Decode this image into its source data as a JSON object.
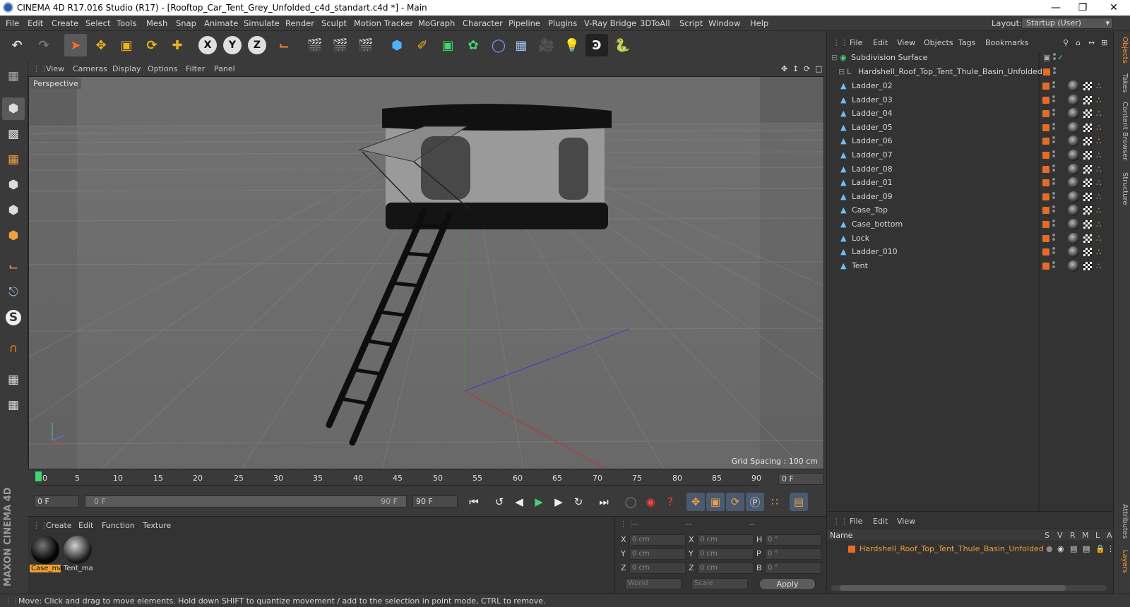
{
  "window": {
    "title": "CINEMA 4D R17.016 Studio (R17) - [Rooftop_Car_Tent_Grey_Unfolded_c4d_standart.c4d *] - Main",
    "minimize": "—",
    "maximize": "❐",
    "close": "✕"
  },
  "menu": [
    "File",
    "Edit",
    "Create",
    "Select",
    "Tools",
    "Mesh",
    "Snap",
    "Animate",
    "Simulate",
    "Render",
    "Sculpt",
    "Motion Tracker",
    "MoGraph",
    "Character",
    "Pipeline",
    "Plugins",
    "V-Ray Bridge",
    "3DToAll",
    "Script",
    "Window",
    "Help"
  ],
  "layout": {
    "label": "Layout:",
    "value": "Startup (User)"
  },
  "toolbar": {
    "x": "X",
    "y": "Y",
    "z": "Z"
  },
  "viewport": {
    "menu": [
      "View",
      "Cameras",
      "Display",
      "Options",
      "Filter",
      "Panel"
    ],
    "label": "Perspective",
    "grid_spacing": "Grid Spacing : 100 cm"
  },
  "timeline": {
    "ticks": [
      "0",
      "5",
      "10",
      "15",
      "20",
      "25",
      "30",
      "35",
      "40",
      "45",
      "50",
      "55",
      "60",
      "65",
      "70",
      "75",
      "80",
      "85",
      "90"
    ],
    "current_frame": "0 F"
  },
  "transport": {
    "start": "0 F",
    "range_start": "0 F",
    "range_end": "90 F",
    "end": "90 F"
  },
  "material_manager": {
    "menu": [
      "Create",
      "Edit",
      "Function",
      "Texture"
    ],
    "materials": [
      {
        "name": "Case_ma",
        "selected": true
      },
      {
        "name": "Tent_ma",
        "selected": false
      }
    ]
  },
  "coordinates": {
    "headers": [
      "--",
      "--",
      "--"
    ],
    "rows": [
      {
        "a": "X",
        "av": "0 cm",
        "b": "X",
        "bv": "0 cm",
        "c": "H",
        "cv": "0 °"
      },
      {
        "a": "Y",
        "av": "0 cm",
        "b": "Y",
        "bv": "0 cm",
        "c": "P",
        "cv": "0 °"
      },
      {
        "a": "Z",
        "av": "0 cm",
        "b": "Z",
        "bv": "0 cm",
        "c": "B",
        "cv": "0 °"
      }
    ],
    "space": "World",
    "mode": "Scale",
    "apply": "Apply"
  },
  "object_manager": {
    "menu": [
      "File",
      "Edit",
      "View",
      "Objects",
      "Tags",
      "Bookmarks"
    ],
    "root": "Subdivision Surface",
    "group": "Hardshell_Roof_Top_Tent_Thule_Basin_Unfolded",
    "objects": [
      "Ladder_02",
      "Ladder_03",
      "Ladder_04",
      "Ladder_05",
      "Ladder_06",
      "Ladder_07",
      "Ladder_08",
      "Ladder_01",
      "Ladder_09",
      "Case_Top",
      "Case_bottom",
      "Lock",
      "Ladder_010",
      "Tent"
    ]
  },
  "layer_manager": {
    "menu": [
      "File",
      "Edit",
      "View"
    ],
    "name_header": "Name",
    "cols": [
      "S",
      "V",
      "R",
      "M",
      "L",
      "A"
    ],
    "layer": "Hardshell_Roof_Top_Tent_Thule_Basin_Unfolded"
  },
  "side_tabs": [
    "Objects",
    "Takes",
    "Content Browser",
    "Structure"
  ],
  "side_tabs_bottom": [
    "Attributes",
    "Layers"
  ],
  "brand": "MAXON CINEMA 4D",
  "status": "Move: Click and drag to move elements. Hold down SHIFT to quantize movement / add to the selection in point mode, CTRL to remove.",
  "colors": {
    "accent": "#e36d28",
    "selected_text": "#f0a030"
  }
}
